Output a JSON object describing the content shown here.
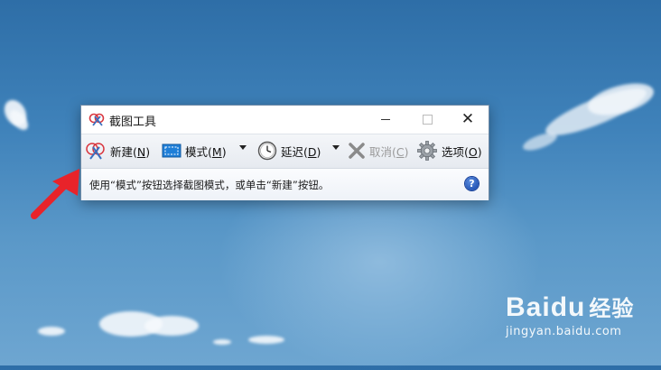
{
  "window": {
    "title": "截图工具",
    "controls": {
      "minimize": "minimize",
      "maximize": "maximize",
      "close": "✕"
    }
  },
  "toolbar": {
    "new": {
      "label": "新建(",
      "key": "N",
      "suffix": ")"
    },
    "mode": {
      "label": "模式(",
      "key": "M",
      "suffix": ")"
    },
    "delay": {
      "label": "延迟(",
      "key": "D",
      "suffix": ")"
    },
    "cancel": {
      "label": "取消(",
      "key": "C",
      "suffix": ")",
      "enabled": false
    },
    "options": {
      "label": "选项(",
      "key": "O",
      "suffix": ")"
    }
  },
  "status": {
    "message": "使用“模式”按钮选择截图模式，或单击“新建”按钮。",
    "help": "?"
  },
  "watermark": {
    "brand": "Bai",
    "brand_mid": "du",
    "brand_cn": "经验",
    "url": "jingyan.baidu.com"
  },
  "colors": {
    "arrow": "#e8232a",
    "help": "#1e4fb0",
    "mode_icon": "#1f7fd8"
  }
}
